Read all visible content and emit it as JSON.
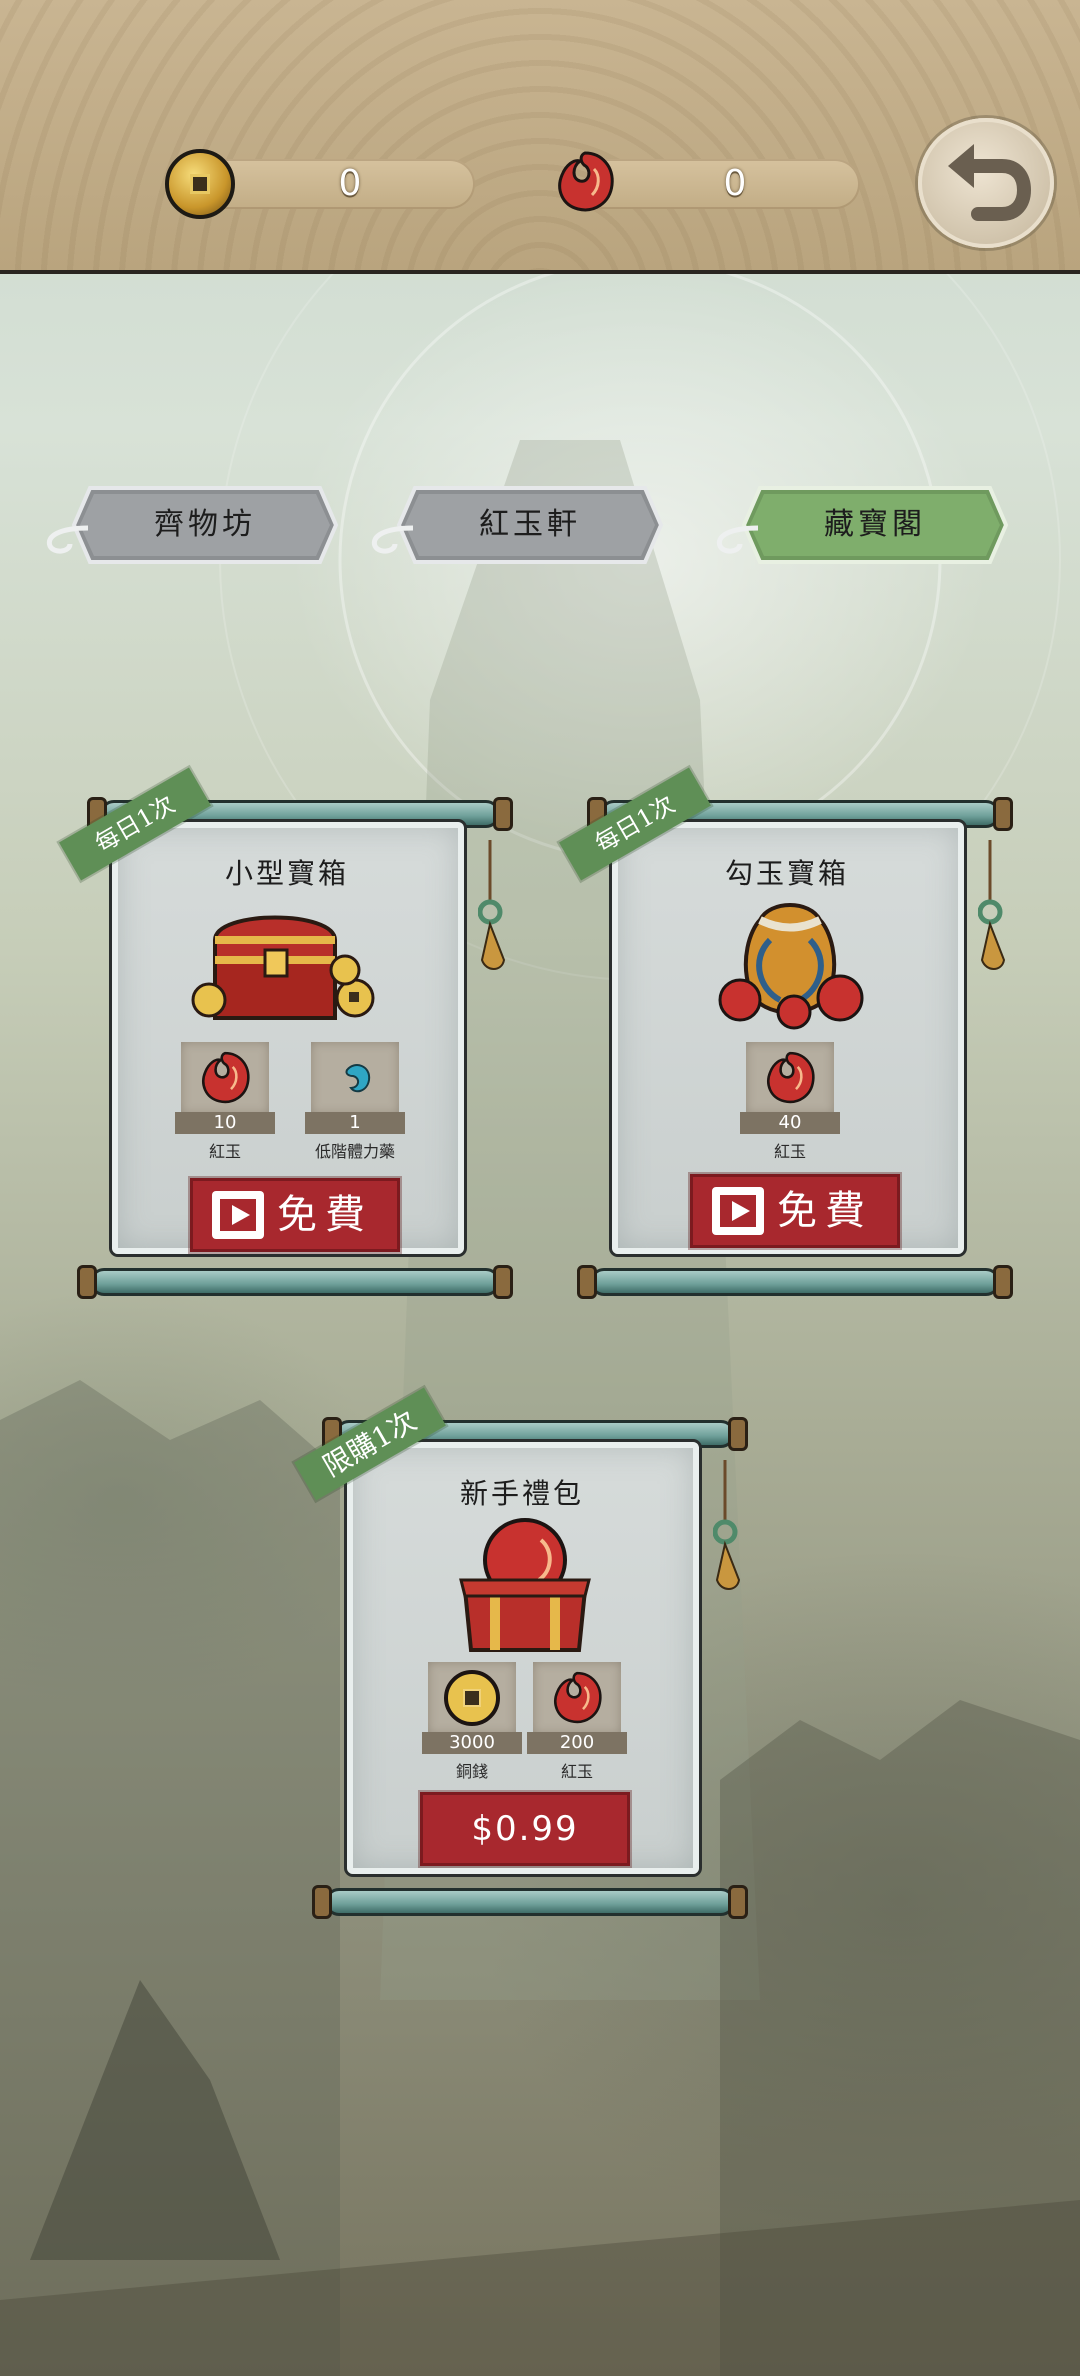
{
  "colors": {
    "accent_green": "#5f8f56",
    "button_red": "#a8282e",
    "bar_tan": "#c2ad86"
  },
  "topbar": {
    "coins": {
      "icon": "copper-coin-icon",
      "value": "0"
    },
    "jade": {
      "icon": "red-jade-icon",
      "value": "0"
    },
    "back": {
      "icon": "return-arrow-icon"
    }
  },
  "tabs": [
    {
      "label": "齊物坊",
      "active": false
    },
    {
      "label": "紅玉軒",
      "active": false
    },
    {
      "label": "藏寶閣",
      "active": true
    }
  ],
  "cards": [
    {
      "ribbon": "每日1次",
      "title": "小型寶箱",
      "image": "treasure-chest-icon",
      "items": [
        {
          "icon": "red-jade-icon",
          "count": "10",
          "name": "紅玉"
        },
        {
          "icon": "stamina-pill-icon",
          "count": "1",
          "name": "低階體力藥"
        }
      ],
      "button": "免費",
      "button_icon": "video-ad-icon"
    },
    {
      "ribbon": "每日1次",
      "title": "勾玉寶箱",
      "image": "jade-pouch-icon",
      "items": [
        {
          "icon": "red-jade-icon",
          "count": "40",
          "name": "紅玉"
        }
      ],
      "button": "免費",
      "button_icon": "video-ad-icon"
    },
    {
      "ribbon": "限購1次",
      "title": "新手禮包",
      "image": "gift-box-icon",
      "items": [
        {
          "icon": "copper-coin-icon",
          "count": "3000",
          "name": "銅錢"
        },
        {
          "icon": "red-jade-icon",
          "count": "200",
          "name": "紅玉"
        }
      ],
      "button": "$0.99"
    }
  ]
}
